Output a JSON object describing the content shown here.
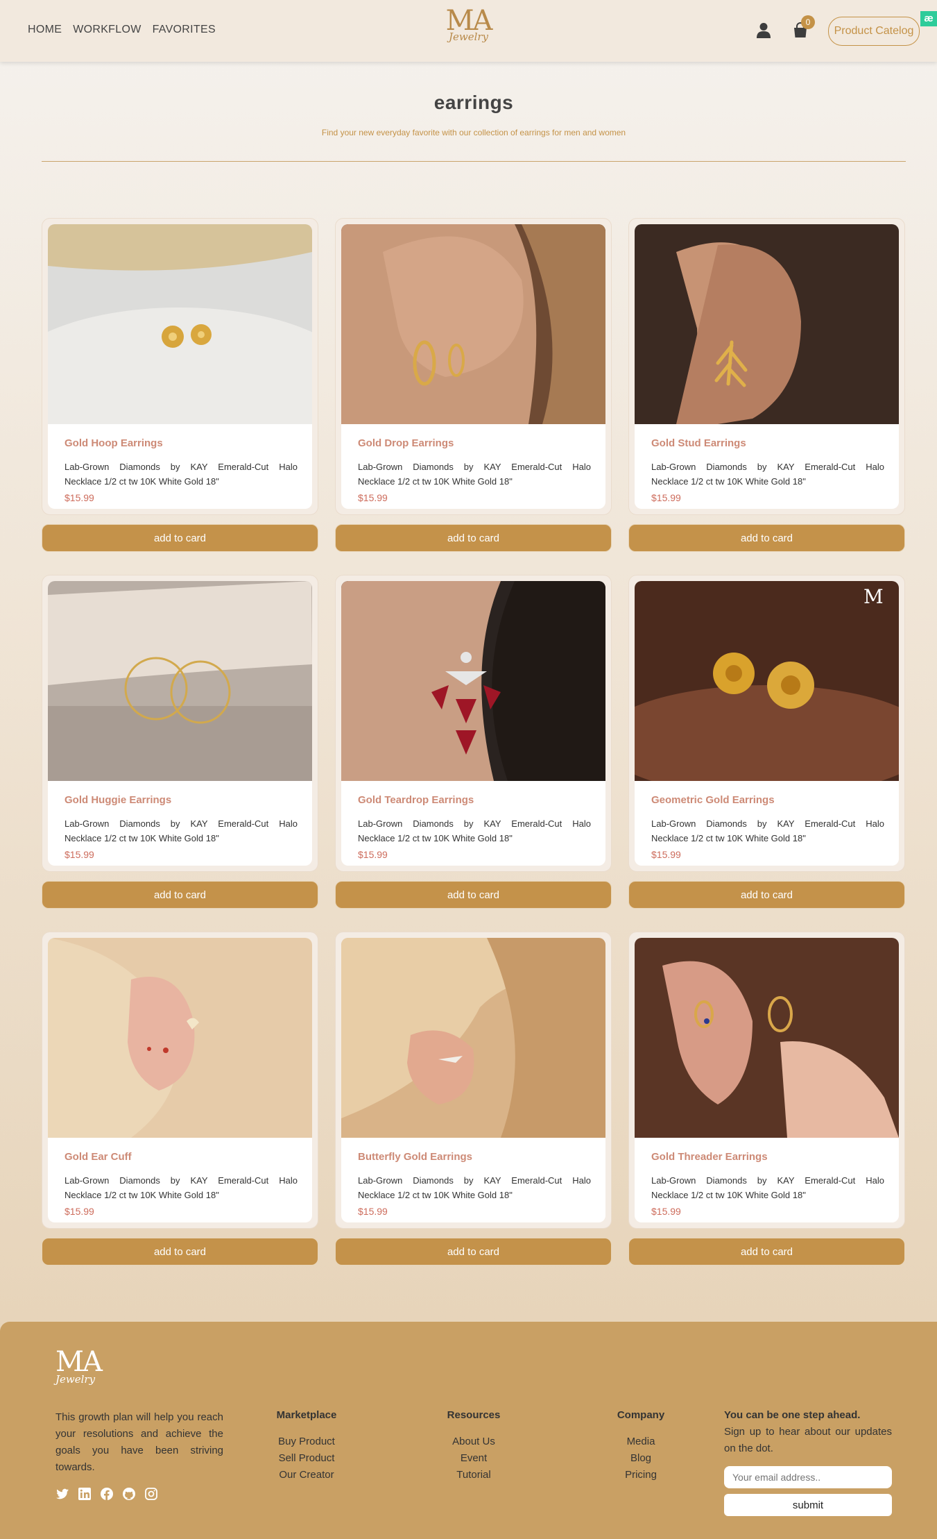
{
  "header": {
    "nav": [
      "HOME",
      "WORKFLOW",
      "FAVORITES"
    ],
    "logo_main": "MA",
    "logo_sub": "Jewelry",
    "cart_count": "0",
    "catalog_label": "Product Catelog",
    "ae_badge": "æ"
  },
  "main": {
    "title": "earrings",
    "subtitle": "Find your new everyday favorite with our collection of earrings for men and women"
  },
  "products": [
    {
      "name": "Gold Hoop Earrings",
      "desc": "Lab-Grown Diamonds by KAY Emerald-Cut Halo Necklace 1/2 ct tw 10K White Gold 18\"",
      "price": "$15.99",
      "button": "add to card"
    },
    {
      "name": "Gold Drop Earrings",
      "desc": "Lab-Grown Diamonds by KAY Emerald-Cut Halo Necklace 1/2 ct tw 10K White Gold 18\"",
      "price": "$15.99",
      "button": "add to card"
    },
    {
      "name": "Gold Stud Earrings",
      "desc": "Lab-Grown Diamonds by KAY Emerald-Cut Halo Necklace 1/2 ct tw 10K White Gold 18\"",
      "price": "$15.99",
      "button": "add to card"
    },
    {
      "name": "Gold Huggie Earrings",
      "desc": "Lab-Grown Diamonds by KAY Emerald-Cut Halo Necklace 1/2 ct tw 10K White Gold 18\"",
      "price": "$15.99",
      "button": "add to card"
    },
    {
      "name": "Gold Teardrop Earrings",
      "desc": "Lab-Grown Diamonds by KAY Emerald-Cut Halo Necklace 1/2 ct tw 10K White Gold 18\"",
      "price": "$15.99",
      "button": "add to card"
    },
    {
      "name": "Geometric Gold Earrings",
      "desc": "Lab-Grown Diamonds by KAY Emerald-Cut Halo Necklace 1/2 ct tw 10K White Gold 18\"",
      "price": "$15.99",
      "button": "add to card"
    },
    {
      "name": "Gold Ear Cuff",
      "desc": "Lab-Grown Diamonds by KAY Emerald-Cut Halo Necklace 1/2 ct tw 10K White Gold 18\"",
      "price": "$15.99",
      "button": "add to card"
    },
    {
      "name": "Butterfly Gold Earrings",
      "desc": "Lab-Grown Diamonds by KAY Emerald-Cut Halo Necklace 1/2 ct tw 10K White Gold 18\"",
      "price": "$15.99",
      "button": "add to card"
    },
    {
      "name": "Gold Threader Earrings",
      "desc": "Lab-Grown Diamonds by KAY Emerald-Cut Halo Necklace 1/2 ct tw 10K White Gold 18\"",
      "price": "$15.99",
      "button": "add to card"
    }
  ],
  "footer": {
    "logo_main": "MA",
    "logo_sub": "Jewelry",
    "about": "This growth plan will help you reach your resolutions and achieve the goals you have been striving towards.",
    "socials": [
      "twitter-icon",
      "linkedin-icon",
      "facebook-icon",
      "github-icon",
      "instagram-icon"
    ],
    "columns": [
      {
        "title": "Marketplace",
        "links": [
          "Buy Product",
          "Sell Product",
          "Our Creator"
        ]
      },
      {
        "title": "Resources",
        "links": [
          "About Us",
          "Event",
          "Tutorial"
        ]
      },
      {
        "title": "Company",
        "links": [
          "Media",
          "Blog",
          "Pricing"
        ]
      }
    ],
    "newsletter": {
      "title": "You can be one step ahead.",
      "text": "Sign up to hear about our updates on the dot.",
      "placeholder": "Your email address..",
      "submit": "submit"
    }
  },
  "colors": {
    "accent": "#c4924a",
    "name": "#cd8a76",
    "price": "#cd6c5c",
    "footer": "#c9a064"
  }
}
